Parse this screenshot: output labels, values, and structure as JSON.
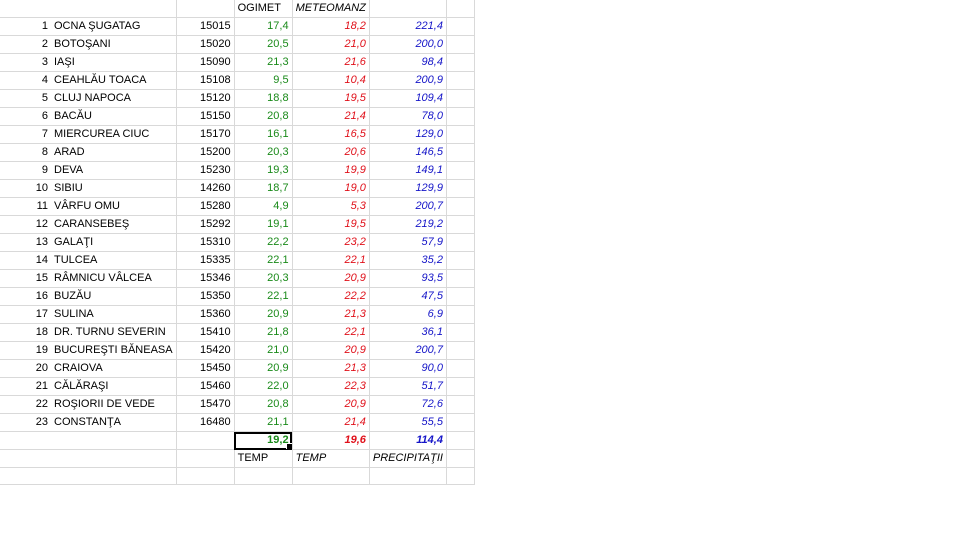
{
  "headers": {
    "ogimet": "OGIMET",
    "meteomanz": "METEOMANZ"
  },
  "rows": [
    {
      "n": "1",
      "name": "OCNA ŞUGATAG",
      "code": "15015",
      "og": "17,4",
      "mt": "18,2",
      "pr": "221,4"
    },
    {
      "n": "2",
      "name": "BOTOŞANI",
      "code": "15020",
      "og": "20,5",
      "mt": "21,0",
      "pr": "200,0"
    },
    {
      "n": "3",
      "name": "IAŞI",
      "code": "15090",
      "og": "21,3",
      "mt": "21,6",
      "pr": "98,4"
    },
    {
      "n": "4",
      "name": "CEAHLĂU TOACA",
      "code": "15108",
      "og": "9,5",
      "mt": "10,4",
      "pr": "200,9"
    },
    {
      "n": "5",
      "name": "CLUJ NAPOCA",
      "code": "15120",
      "og": "18,8",
      "mt": "19,5",
      "pr": "109,4"
    },
    {
      "n": "6",
      "name": "BACĂU",
      "code": "15150",
      "og": "20,8",
      "mt": "21,4",
      "pr": "78,0"
    },
    {
      "n": "7",
      "name": "MIERCUREA CIUC",
      "code": "15170",
      "og": "16,1",
      "mt": "16,5",
      "pr": "129,0"
    },
    {
      "n": "8",
      "name": "ARAD",
      "code": "15200",
      "og": "20,3",
      "mt": "20,6",
      "pr": "146,5"
    },
    {
      "n": "9",
      "name": "DEVA",
      "code": "15230",
      "og": "19,3",
      "mt": "19,9",
      "pr": "149,1"
    },
    {
      "n": "10",
      "name": "SIBIU",
      "code": "14260",
      "og": "18,7",
      "mt": "19,0",
      "pr": "129,9"
    },
    {
      "n": "11",
      "name": "VÂRFU OMU",
      "code": "15280",
      "og": "4,9",
      "mt": "5,3",
      "pr": "200,7"
    },
    {
      "n": "12",
      "name": "CARANSEBEŞ",
      "code": "15292",
      "og": "19,1",
      "mt": "19,5",
      "pr": "219,2"
    },
    {
      "n": "13",
      "name": "GALAŢI",
      "code": "15310",
      "og": "22,2",
      "mt": "23,2",
      "pr": "57,9"
    },
    {
      "n": "14",
      "name": "TULCEA",
      "code": "15335",
      "og": "22,1",
      "mt": "22,1",
      "pr": "35,2"
    },
    {
      "n": "15",
      "name": "RÂMNICU VÂLCEA",
      "code": "15346",
      "og": "20,3",
      "mt": "20,9",
      "pr": "93,5"
    },
    {
      "n": "16",
      "name": "BUZĂU",
      "code": "15350",
      "og": "22,1",
      "mt": "22,2",
      "pr": "47,5"
    },
    {
      "n": "17",
      "name": "SULINA",
      "code": "15360",
      "og": "20,9",
      "mt": "21,3",
      "pr": "6,9"
    },
    {
      "n": "18",
      "name": "DR. TURNU SEVERIN",
      "code": "15410",
      "og": "21,8",
      "mt": "22,1",
      "pr": "36,1"
    },
    {
      "n": "19",
      "name": "BUCUREŞTI BĂNEASA",
      "code": "15420",
      "og": "21,0",
      "mt": "20,9",
      "pr": "200,7"
    },
    {
      "n": "20",
      "name": "CRAIOVA",
      "code": "15450",
      "og": "20,9",
      "mt": "21,3",
      "pr": "90,0"
    },
    {
      "n": "21",
      "name": "CĂLĂRAŞI",
      "code": "15460",
      "og": "22,0",
      "mt": "22,3",
      "pr": "51,7"
    },
    {
      "n": "22",
      "name": "ROŞIORII DE VEDE",
      "code": "15470",
      "og": "20,8",
      "mt": "20,9",
      "pr": "72,6"
    },
    {
      "n": "23",
      "name": "CONSTANŢA",
      "code": "16480",
      "og": "21,1",
      "mt": "21,4",
      "pr": "55,5"
    }
  ],
  "totals": {
    "og": "19,2",
    "mt": "19,6",
    "pr": "114,4"
  },
  "footer": {
    "og": "TEMP",
    "mt": "TEMP",
    "pr": "PRECIPITAŢII"
  },
  "colors": {
    "ogimet": "#1a8a1a",
    "meteomanz": "#e0101a",
    "precip": "#1515c8",
    "grid": "#d9d9d9"
  }
}
